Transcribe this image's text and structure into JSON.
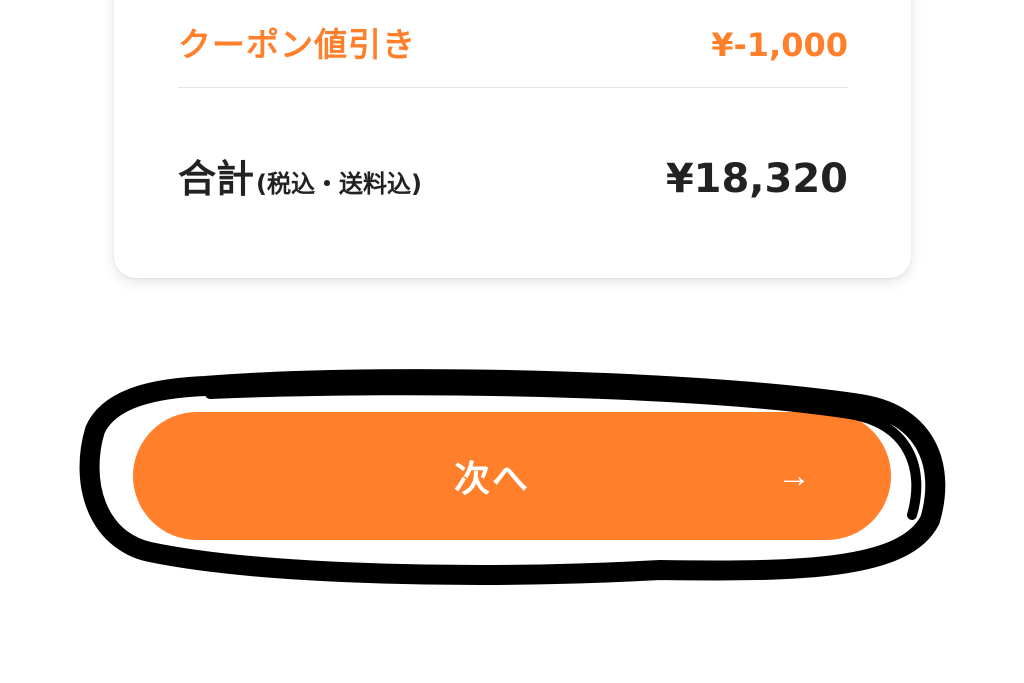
{
  "summary": {
    "coupon_label": "クーポン値引き",
    "coupon_value": "¥-1,000",
    "total_label": "合計",
    "total_note": "(税込・送料込)",
    "total_value": "¥18,320"
  },
  "next_button": {
    "label": "次へ",
    "arrow": "→"
  },
  "colors": {
    "accent": "#FF7F2A",
    "text": "#222222",
    "annotation": "#000000"
  },
  "icons": {
    "next_arrow": "arrow-right-icon"
  }
}
